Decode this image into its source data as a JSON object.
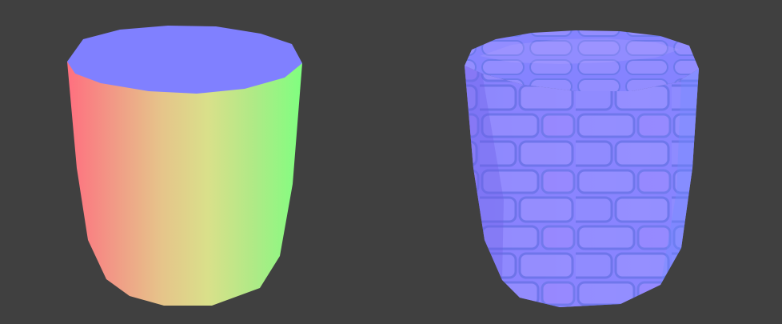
{
  "scene": {
    "background": "#404040",
    "objects": [
      {
        "id": "object-space-normal-cylinder",
        "side_colors": [
          "#ff6f7f",
          "#f19a86",
          "#e6c48a",
          "#d9e08a",
          "#aeea86",
          "#7fff80"
        ],
        "cap_color": "#8080ff"
      },
      {
        "id": "tangent-space-normal-cylinder",
        "base_color": "#8a84ff",
        "cap_color": "#8583ff",
        "highlight_color": "#b9a8ff",
        "shadow_color": "#5e6ee6",
        "mortar_color": "#9a90e6"
      }
    ]
  }
}
